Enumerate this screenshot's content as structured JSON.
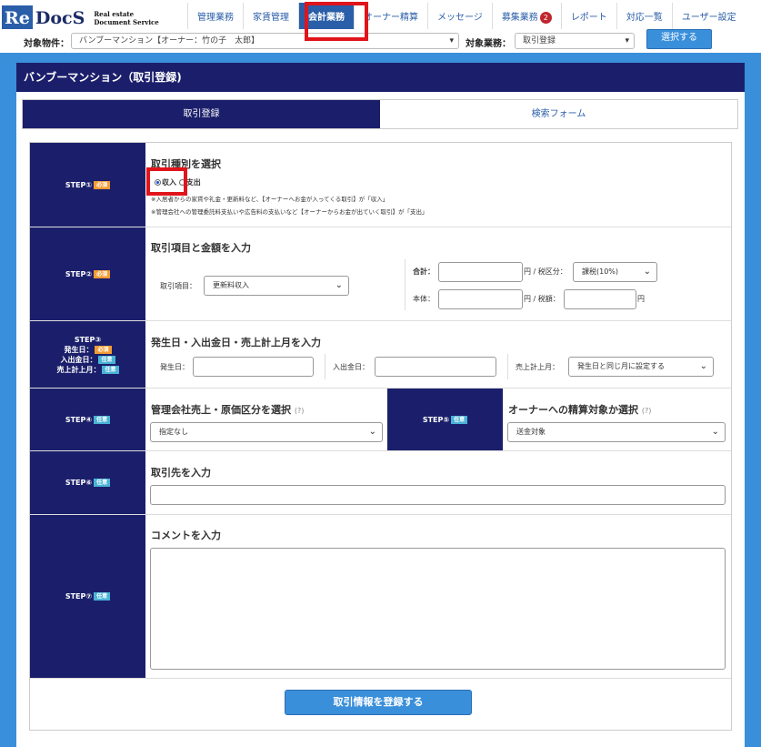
{
  "header": {
    "logo_re": "Re",
    "logo_docs": "DocS",
    "logo_sub1": "Real estate",
    "logo_sub2": "Document Service",
    "nav": [
      {
        "label": "管理業務"
      },
      {
        "label": "家賃管理"
      },
      {
        "label": "会計業務"
      },
      {
        "label": "オーナー精算"
      },
      {
        "label": "メッセージ"
      },
      {
        "label": "募集業務",
        "badge": "2"
      },
      {
        "label": "レポート"
      },
      {
        "label": "対応一覧"
      },
      {
        "label": "ユーザー設定"
      }
    ]
  },
  "filter": {
    "property_label": "対象物件：",
    "property_value": "バンブーマンション【オーナー：竹の子　太郎】",
    "task_label": "対象業務：",
    "task_value": "取引登録",
    "select_button": "選択する"
  },
  "panel": {
    "title": "バンブーマンション（取引登録)",
    "tabs": [
      "取引登録",
      "検索フォーム"
    ]
  },
  "tags": {
    "required": "必須",
    "optional": "任意"
  },
  "step1": {
    "label": "STEP①",
    "heading": "取引種別を選択",
    "income": "収入",
    "expense": "支出",
    "note1": "※入居者からの家賃や礼金・更新料など、【オーナーへお金が入ってくる取引】が「収入」",
    "note2": "※管理会社への管理委託料支払いや広告料の支払いなど【オーナーからお金が出ていく取引】が「支出」"
  },
  "step2": {
    "label": "STEP②",
    "heading": "取引項目と金額を入力",
    "item_label": "取引項目：",
    "item_value": "更新料収入",
    "total_label": "合計：",
    "tax_class_label": "円 / 税区分：",
    "tax_class_value": "課税(10%)",
    "base_label": "本体：",
    "tax_label": "円 / 税額：",
    "yen": "円"
  },
  "step3": {
    "label": "STEP③",
    "sub1": "発生日：",
    "sub2": "入出金日：",
    "sub3": "売上計上月：",
    "heading": "発生日・入出金日・売上計上月を入力",
    "occur_label": "発生日：",
    "pay_label": "入出金日：",
    "sales_label": "売上計上月：",
    "sales_value": "発生日と同じ月に設定する"
  },
  "step4": {
    "label": "STEP④",
    "heading": "管理会社売上・原価区分を選択",
    "help": "(?)",
    "value": "指定なし"
  },
  "step5": {
    "label": "STEP⑤",
    "heading": "オーナーへの精算対象か選択",
    "help": "(?)",
    "value": "送金対象"
  },
  "step6": {
    "label": "STEP⑥",
    "heading": "取引先を入力"
  },
  "step7": {
    "label": "STEP⑦",
    "heading": "コメントを入力"
  },
  "submit": "取引情報を登録する"
}
